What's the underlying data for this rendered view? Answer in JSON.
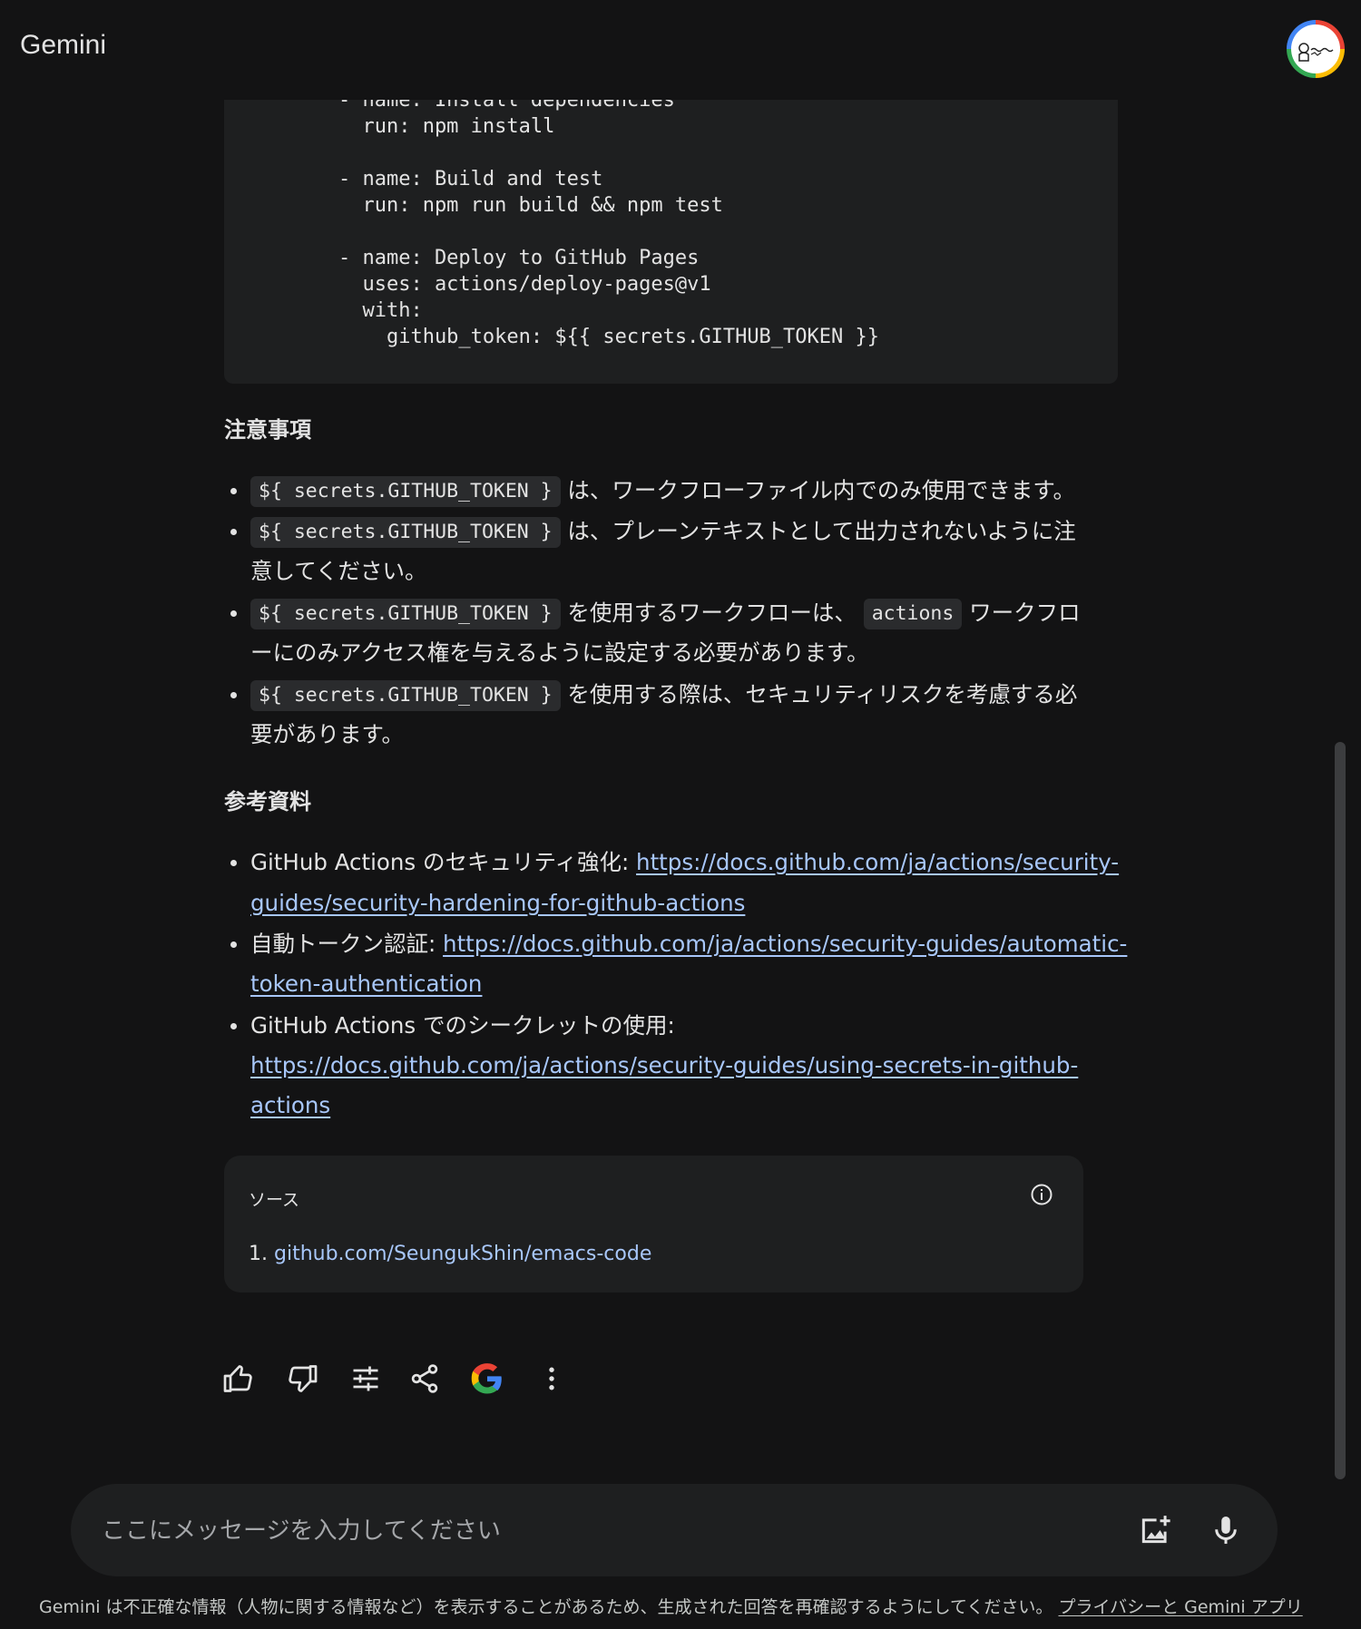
{
  "app": {
    "title": "Gemini"
  },
  "code": {
    "lines": [
      "    - name: Install dependencies",
      "      run: npm install",
      "",
      "    - name: Build and test",
      "      run: npm run build && npm test",
      "",
      "    - name: Deploy to GitHub Pages",
      "      uses: actions/deploy-pages@v1",
      "      with:",
      "        github_token: ${{ secrets.GITHUB_TOKEN }}"
    ]
  },
  "notes": {
    "heading": "注意事項",
    "token_code": "${ secrets.GITHUB_TOKEN }",
    "actions_code": "actions",
    "item1_text": "は、ワークフローファイル内でのみ使用できます。",
    "item2_text_a": "は、プレーンテキストとして出力されないように注",
    "item2_text_b": "意してください。",
    "item3_text_a": "を使用するワークフローは、",
    "item3_text_b": "ワークフロ",
    "item3_text_c": "ーにのみアクセス権を与えるように設定する必要があります。",
    "item4_text_a": "を使用する際は、セキュリティリスクを考慮する必",
    "item4_text_b": "要があります。"
  },
  "references": {
    "heading": "参考資料",
    "ref1_label": "GitHub Actions のセキュリティ強化: ",
    "ref1_link_a": "https://docs.github.com/ja/actions/security-",
    "ref1_link_b": "guides/security-hardening-for-github-actions",
    "ref2_label": "自動トークン認証: ",
    "ref2_link_a": "https://docs.github.com/ja/actions/security-guides/automatic-",
    "ref2_link_b": "token-authentication",
    "ref3_label": "GitHub Actions でのシークレットの使用:",
    "ref3_link_a": "https://docs.github.com/ja/actions/security-guides/using-secrets-in-github-",
    "ref3_link_b": "actions"
  },
  "sources": {
    "label": "ソース",
    "item_number": "1.",
    "item_link": "github.com/SeungukShin/emacs-code"
  },
  "actions": {
    "icons": [
      "thumb-up-icon",
      "thumb-down-icon",
      "tune-icon",
      "share-icon",
      "google-icon",
      "more-vert-icon"
    ]
  },
  "input": {
    "placeholder": "ここにメッセージを入力してください"
  },
  "footer": {
    "text": "Gemini は不正確な情報（人物に関する情報など）を表示することがあるため、生成された回答を再確認するようにしてください。",
    "link": "プライバシーと Gemini アプリ"
  },
  "colors": {
    "background": "#131314",
    "surface": "#1e1f20",
    "text": "#e3e3e3",
    "link": "#a8c7fa"
  }
}
